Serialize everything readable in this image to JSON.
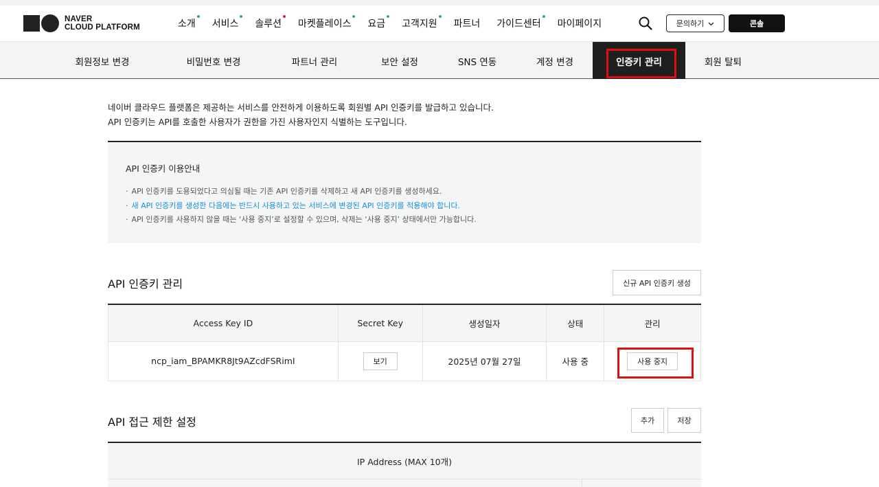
{
  "header": {
    "logo_line1": "NAVER",
    "logo_line2": "CLOUD PLATFORM",
    "gnb": [
      {
        "label": "소개",
        "dot": "#2bb36b"
      },
      {
        "label": "서비스",
        "dot": "#2bb36b"
      },
      {
        "label": "솔루션",
        "dot": "#e0203a"
      },
      {
        "label": "마켓플레이스",
        "dot": "#2bb36b"
      },
      {
        "label": "요금",
        "dot": "#2bb36b"
      },
      {
        "label": "고객지원",
        "dot": "#2bb36b"
      },
      {
        "label": "파트너",
        "dot": ""
      },
      {
        "label": "가이드센터",
        "dot": "#2bb36b"
      },
      {
        "label": "마이페이지",
        "dot": ""
      }
    ],
    "search_icon": "search-icon",
    "inquiry_label": "문의하기",
    "console_label": "콘솔"
  },
  "subnav": {
    "tabs": [
      {
        "label": "회원정보 변경"
      },
      {
        "label": "비밀번호 변경"
      },
      {
        "label": "파트너 관리"
      },
      {
        "label": "보안 설정"
      },
      {
        "label": "SNS 연동"
      },
      {
        "label": "계정 변경"
      },
      {
        "label": "인증키 관리"
      },
      {
        "label": "회원 탈퇴"
      }
    ],
    "active_index": 6
  },
  "intro": {
    "line1": "네이버 클라우드 플랫폼은 제공하는 서비스를 안전하게 이용하도록 회원별 API 인증키를 발급하고 있습니다.",
    "line2": "API 인증키는 API를 호출한 사용자가 권한을 가진 사용자인지 식별하는 도구입니다."
  },
  "notice": {
    "title": "API 인증키 이용안내",
    "items": [
      "API 인증키를 도용되었다고 의심될 때는 기존 API 인증키를 삭제하고 새 API 인증키를 생성하세요.",
      "새 API 인증키를 생성한 다음에는 반드시 사용하고 있는 서비스에 변경된 API 인증키를 적용해야 합니다.",
      "API 인증키를 사용하지 않을 때는 ‘사용 중지’로 설정할 수 있으며, 삭제는 ‘사용 중지’ 상태에서만 가능합니다."
    ],
    "highlight_color": "#1a8fd6"
  },
  "key_section": {
    "title": "API 인증키 관리",
    "create_button": "신규 API 인증키 생성",
    "columns": [
      "Access Key ID",
      "Secret Key",
      "생성일자",
      "상태",
      "관리"
    ],
    "rows": [
      {
        "access_key_id": "ncp_iam_BPAMKR8Jt9AZcdFSRimI",
        "secret_button": "보기",
        "created": "2025년 07월 27일",
        "status": "사용 중",
        "manage_button": "사용 중지"
      }
    ]
  },
  "access_section": {
    "title": "API 접근 제한 설정",
    "add_button": "추가",
    "save_button": "저장",
    "ip_header": "IP Address (MAX 10개)"
  },
  "highlight_color": "#e01010"
}
